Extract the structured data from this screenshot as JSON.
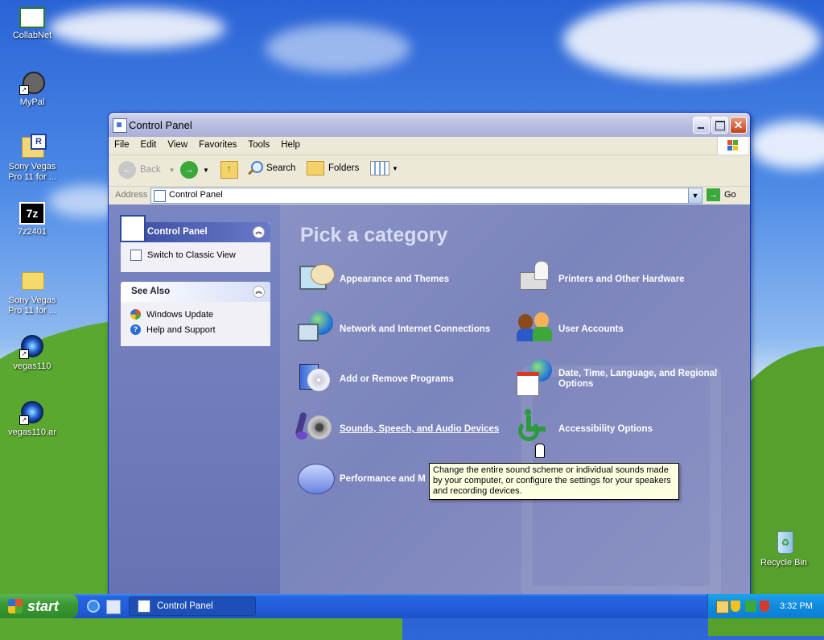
{
  "desktop": {
    "icons": [
      {
        "label": "CollabNet",
        "icon": "certificate-icon"
      },
      {
        "label": "MyPal",
        "icon": "raccoon-shortcut-icon"
      },
      {
        "label": "Sony Vegas\nPro 11 for ...",
        "icon": "file-icon"
      },
      {
        "label": "7z2401",
        "icon": "7zip-icon"
      },
      {
        "label": "Sony Vegas\nPro 11 for ...",
        "icon": "folder-icon"
      },
      {
        "label": "vegas110",
        "icon": "vegas-shortcut-icon"
      },
      {
        "label": "vegas110.ar",
        "icon": "vegas-shortcut-icon"
      },
      {
        "label": "Recycle Bin",
        "icon": "recycle-bin-icon"
      }
    ]
  },
  "window": {
    "title": "Control Panel",
    "menu": [
      "File",
      "Edit",
      "View",
      "Favorites",
      "Tools",
      "Help"
    ],
    "toolbar": {
      "back": "Back",
      "search": "Search",
      "folders": "Folders"
    },
    "address": {
      "label": "Address",
      "value": "Control Panel",
      "go": "Go"
    }
  },
  "left_pane": {
    "control_panel": {
      "title": "Control Panel",
      "switch_link": "Switch to Classic View"
    },
    "see_also": {
      "title": "See Also",
      "items": [
        "Windows Update",
        "Help and Support"
      ]
    }
  },
  "main": {
    "heading": "Pick a category",
    "categories": [
      {
        "label": "Appearance and Themes",
        "icon": "appearance-icon"
      },
      {
        "label": "Printers and Other Hardware",
        "icon": "printer-icon"
      },
      {
        "label": "Network and Internet Connections",
        "icon": "network-icon"
      },
      {
        "label": "User Accounts",
        "icon": "users-icon"
      },
      {
        "label": "Add or Remove Programs",
        "icon": "programs-icon"
      },
      {
        "label": "Date, Time, Language, and Regional Options",
        "icon": "datetime-icon"
      },
      {
        "label": "Sounds, Speech, and Audio Devices",
        "icon": "sound-icon"
      },
      {
        "label": "Accessibility Options",
        "icon": "accessibility-icon"
      },
      {
        "label": "Performance and M",
        "icon": "performance-icon"
      }
    ],
    "tooltip": "Change the entire sound scheme or individual sounds made by your computer, or configure the settings for your speakers and recording devices."
  },
  "taskbar": {
    "start": "start",
    "task": "Control Panel",
    "clock": "3:32 PM"
  },
  "colors": {
    "panel_header": "#d6dff7",
    "taskbar_blue": "#245edb",
    "start_green": "#3a9a35",
    "tray_blue": "#0f8bdd"
  }
}
